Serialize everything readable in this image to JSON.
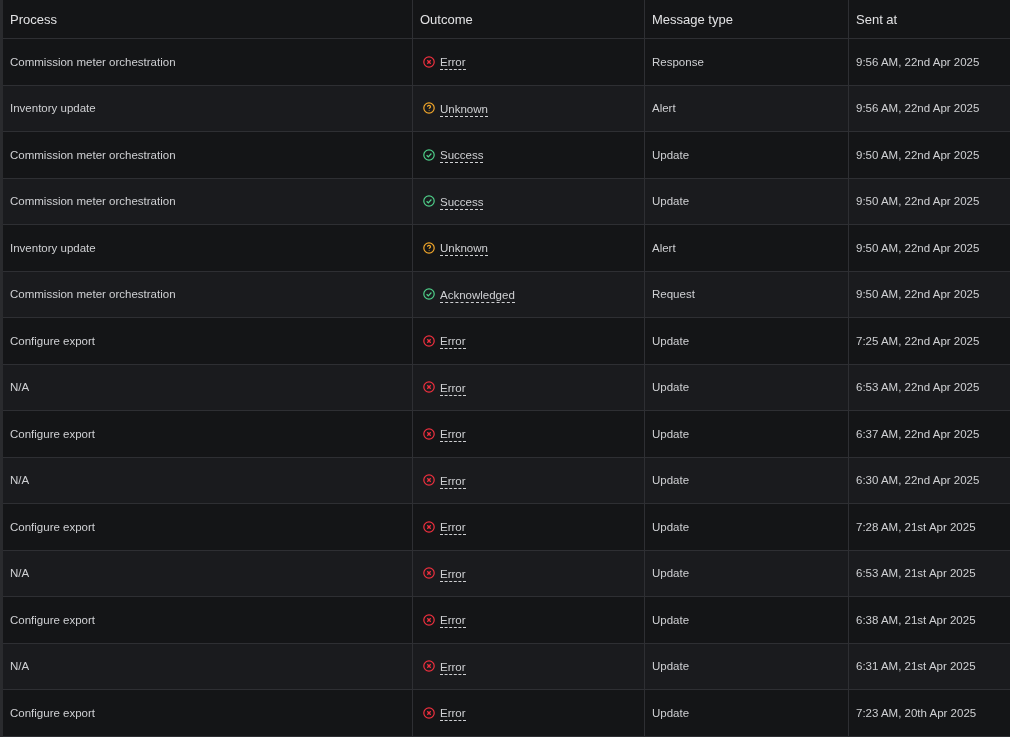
{
  "table": {
    "columns": [
      "Process",
      "Outcome",
      "Message type",
      "Sent at"
    ],
    "rows": [
      {
        "process": "Commission meter orchestration",
        "outcome": "Error",
        "kind": "error",
        "message_type": "Response",
        "sent_at": "9:56 AM, 22nd Apr 2025"
      },
      {
        "process": "Inventory update",
        "outcome": "Unknown",
        "kind": "unknown",
        "message_type": "Alert",
        "sent_at": "9:56 AM, 22nd Apr 2025"
      },
      {
        "process": "Commission meter orchestration",
        "outcome": "Success",
        "kind": "success",
        "message_type": "Update",
        "sent_at": "9:50 AM, 22nd Apr 2025"
      },
      {
        "process": "Commission meter orchestration",
        "outcome": "Success",
        "kind": "success",
        "message_type": "Update",
        "sent_at": "9:50 AM, 22nd Apr 2025"
      },
      {
        "process": "Inventory update",
        "outcome": "Unknown",
        "kind": "unknown",
        "message_type": "Alert",
        "sent_at": "9:50 AM, 22nd Apr 2025"
      },
      {
        "process": "Commission meter orchestration",
        "outcome": "Acknowledged",
        "kind": "success",
        "message_type": "Request",
        "sent_at": "9:50 AM, 22nd Apr 2025"
      },
      {
        "process": "Configure export",
        "outcome": "Error",
        "kind": "error",
        "message_type": "Update",
        "sent_at": "7:25 AM, 22nd Apr 2025"
      },
      {
        "process": "N/A",
        "outcome": "Error",
        "kind": "error",
        "message_type": "Update",
        "sent_at": "6:53 AM, 22nd Apr 2025"
      },
      {
        "process": "Configure export",
        "outcome": "Error",
        "kind": "error",
        "message_type": "Update",
        "sent_at": "6:37 AM, 22nd Apr 2025"
      },
      {
        "process": "N/A",
        "outcome": "Error",
        "kind": "error",
        "message_type": "Update",
        "sent_at": "6:30 AM, 22nd Apr 2025"
      },
      {
        "process": "Configure export",
        "outcome": "Error",
        "kind": "error",
        "message_type": "Update",
        "sent_at": "7:28 AM, 21st Apr 2025"
      },
      {
        "process": "N/A",
        "outcome": "Error",
        "kind": "error",
        "message_type": "Update",
        "sent_at": "6:53 AM, 21st Apr 2025"
      },
      {
        "process": "Configure export",
        "outcome": "Error",
        "kind": "error",
        "message_type": "Update",
        "sent_at": "6:38 AM, 21st Apr 2025"
      },
      {
        "process": "N/A",
        "outcome": "Error",
        "kind": "error",
        "message_type": "Update",
        "sent_at": "6:31 AM, 21st Apr 2025"
      },
      {
        "process": "Configure export",
        "outcome": "Error",
        "kind": "error",
        "message_type": "Update",
        "sent_at": "7:23 AM, 20th Apr 2025"
      }
    ]
  }
}
